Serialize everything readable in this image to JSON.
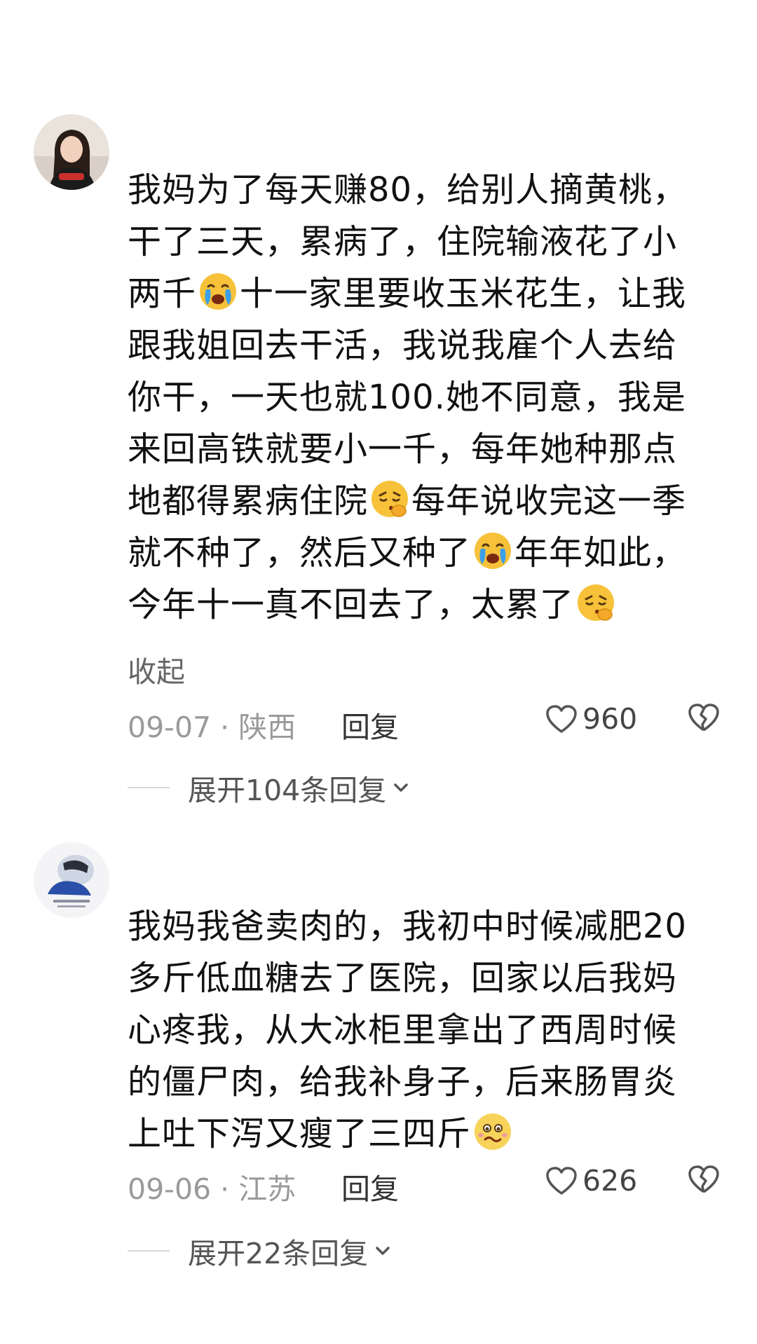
{
  "comments": [
    {
      "lines": [
        [
          {
            "t": "我妈为了每天赚80，给别人摘黄桃，"
          }
        ],
        [
          {
            "t": "干了三天，累病了，住院输液花了小"
          }
        ],
        [
          {
            "t": "两千"
          },
          {
            "e": "crying-face-emoji"
          },
          {
            "t": "十一家里要收玉米花生，让我"
          }
        ],
        [
          {
            "t": "跟我姐回去干活，我说我雇个人去给"
          }
        ],
        [
          {
            "t": "你干，一天也就100.她不同意，我是"
          }
        ],
        [
          {
            "t": "来回高铁就要小一千，每年她种那点"
          }
        ],
        [
          {
            "t": "地都得累病住院"
          },
          {
            "e": "tired-face-emoji"
          },
          {
            "t": "每年说收完这一季"
          }
        ],
        [
          {
            "t": "就不种了，然后又种了"
          },
          {
            "e": "crying-face-emoji"
          },
          {
            "t": "年年如此，"
          }
        ],
        [
          {
            "t": "今年十一真不回去了，太累了"
          },
          {
            "e": "tired-face-emoji"
          }
        ]
      ],
      "collapse_label": "收起",
      "date": "09-07 · 陕西",
      "reply_label": "回复",
      "likes": "960",
      "expand_label": "展开104条回复"
    },
    {
      "lines": [
        [
          {
            "t": "我妈我爸卖肉的，我初中时候减肥20"
          }
        ],
        [
          {
            "t": "多斤低血糖去了医院，回家以后我妈"
          }
        ],
        [
          {
            "t": "心疼我，从大冰柜里拿出了西周时候"
          }
        ],
        [
          {
            "t": "的僵尸肉，给我补身子，后来肠胃炎"
          }
        ],
        [
          {
            "t": "上吐下泻又瘦了三四斤"
          },
          {
            "e": "sick-face-emoji"
          }
        ]
      ],
      "date": "09-06 · 江苏",
      "reply_label": "回复",
      "likes": "626",
      "expand_label": "展开22条回复"
    }
  ],
  "icons": {
    "like": "heart-icon",
    "dislike": "broken-heart-icon",
    "expand": "chevron-down-icon"
  },
  "colors": {
    "text": "#111111",
    "meta": "#9a9a9a",
    "emoji_yellow": "#f7c23a",
    "tear_blue": "#3aa0ea"
  }
}
